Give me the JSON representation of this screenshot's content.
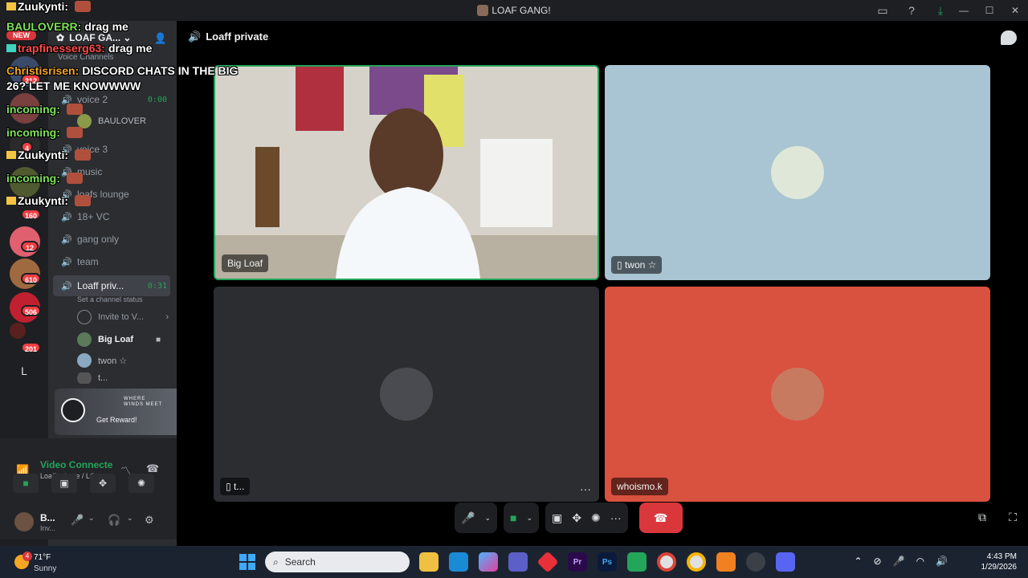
{
  "window": {
    "title": "LOAF GANG!",
    "controls": [
      "minimize-icon",
      "maximize-icon",
      "close-icon"
    ],
    "toolbar_icons": [
      "inbox-icon",
      "help-icon",
      "download-icon"
    ]
  },
  "rail": {
    "servers": [
      {
        "badge": "212"
      },
      {
        "badge": ""
      },
      {
        "badge": "4"
      },
      {
        "badge": ""
      },
      {
        "badge": "160"
      },
      {
        "badge": "12"
      },
      {
        "badge": "610"
      },
      {
        "badge": "506"
      },
      {
        "badge": "201"
      }
    ],
    "letter": "L"
  },
  "sidebar": {
    "server_name": "LOAF GA...",
    "section": "Voice Channels",
    "channels": [
      {
        "label": "voice 2",
        "time": "0:00"
      },
      {
        "label": "BAULOVER",
        "time": ""
      },
      {
        "label": "voice 3",
        "time": ""
      },
      {
        "label": "music",
        "time": ""
      },
      {
        "label": "loafs lounge",
        "time": ""
      },
      {
        "label": "18+ VC",
        "time": ""
      },
      {
        "label": "gang only",
        "time": ""
      },
      {
        "label": "team",
        "time": ""
      }
    ],
    "active_channel": {
      "label": "Loaff priv...",
      "time": "0:31",
      "status": "Set a channel status"
    },
    "invite": "Invite to V...",
    "members": [
      {
        "name": "Big Loaf"
      },
      {
        "name": "twon ☆"
      },
      {
        "name": "t..."
      }
    ]
  },
  "reward": {
    "title_line1": "WHERE",
    "title_line2": "WINDS MEET",
    "button": "Get Reward!"
  },
  "voice_panel": {
    "title": "Video Connected",
    "subtitle": "Loaff private / LO..."
  },
  "user_panel": {
    "name": "B...",
    "status": "Inv..."
  },
  "main": {
    "channel": "Loaff private",
    "tiles": [
      {
        "label": "Big Loaf"
      },
      {
        "label": "twon ☆"
      },
      {
        "label": "t..."
      },
      {
        "label": "whoismo.k"
      }
    ],
    "more": "···"
  },
  "overlay": {
    "new_tag": "NEW",
    "messages": [
      {
        "name": "Zuukynti:",
        "text": "",
        "color": "#ffffff"
      },
      {
        "name": "BAULOVERR:",
        "text": "drag me",
        "color": "#7ee05a"
      },
      {
        "name": "trapfinesserg63:",
        "text": "drag me",
        "color": "#ff4d4d"
      },
      {
        "name": "Christisrisen:",
        "text": "DISCORD CHATS IN THE BIG",
        "color": "#f5a623"
      },
      {
        "name": "",
        "text": "26? LET ME KNOWWWW",
        "color": "#ffffff"
      },
      {
        "name": "incoming:",
        "text": "",
        "color": "#7ee05a"
      },
      {
        "name": "incoming:",
        "text": "",
        "color": "#7ee05a"
      },
      {
        "name": "Zuukynti:",
        "text": "",
        "color": "#ffffff"
      },
      {
        "name": "incoming:",
        "text": "",
        "color": "#7ee05a"
      },
      {
        "name": "Zuukynti:",
        "text": "",
        "color": "#ffffff"
      }
    ]
  },
  "taskbar": {
    "weather_badge": "4",
    "temp": "71°F",
    "condition": "Sunny",
    "search_placeholder": "Search",
    "apps": [
      "File Explorer",
      "Edge",
      "Copilot",
      "Teams",
      "Pictures",
      "Premiere",
      "Photoshop",
      "Game",
      "Chrome",
      "Chrome",
      "Ai",
      "App",
      "Discord"
    ],
    "time": "4:43 PM",
    "date": "1/29/2026"
  },
  "colors": {
    "accent_green": "#23a55a",
    "hangup_red": "#da373c",
    "rail_bg": "#1e1f22",
    "sidebar_bg": "#2b2d31"
  }
}
